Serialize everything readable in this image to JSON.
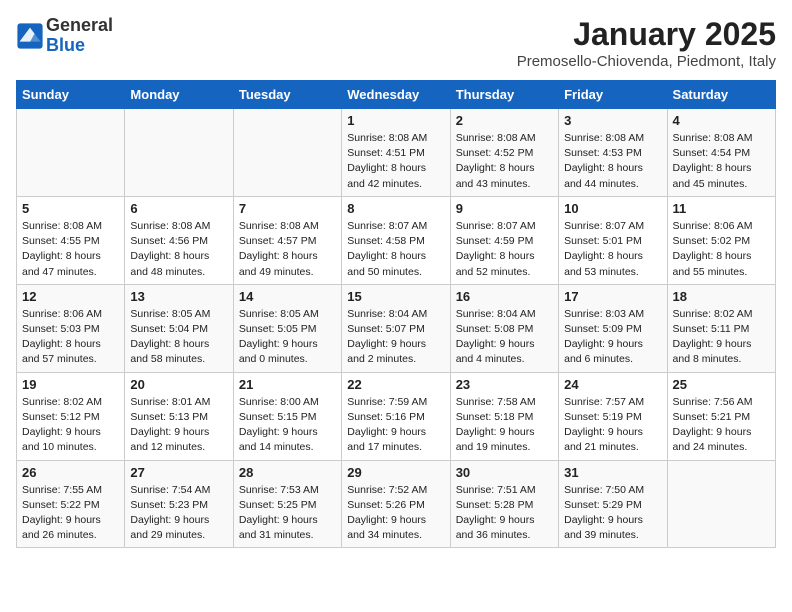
{
  "header": {
    "logo_line1": "General",
    "logo_line2": "Blue",
    "month_year": "January 2025",
    "location": "Premosello-Chiovenda, Piedmont, Italy"
  },
  "weekdays": [
    "Sunday",
    "Monday",
    "Tuesday",
    "Wednesday",
    "Thursday",
    "Friday",
    "Saturday"
  ],
  "weeks": [
    [
      {
        "day": "",
        "sunrise": "",
        "sunset": "",
        "daylight": ""
      },
      {
        "day": "",
        "sunrise": "",
        "sunset": "",
        "daylight": ""
      },
      {
        "day": "",
        "sunrise": "",
        "sunset": "",
        "daylight": ""
      },
      {
        "day": "1",
        "sunrise": "8:08 AM",
        "sunset": "4:51 PM",
        "daylight": "8 hours and 42 minutes."
      },
      {
        "day": "2",
        "sunrise": "8:08 AM",
        "sunset": "4:52 PM",
        "daylight": "8 hours and 43 minutes."
      },
      {
        "day": "3",
        "sunrise": "8:08 AM",
        "sunset": "4:53 PM",
        "daylight": "8 hours and 44 minutes."
      },
      {
        "day": "4",
        "sunrise": "8:08 AM",
        "sunset": "4:54 PM",
        "daylight": "8 hours and 45 minutes."
      }
    ],
    [
      {
        "day": "5",
        "sunrise": "8:08 AM",
        "sunset": "4:55 PM",
        "daylight": "8 hours and 47 minutes."
      },
      {
        "day": "6",
        "sunrise": "8:08 AM",
        "sunset": "4:56 PM",
        "daylight": "8 hours and 48 minutes."
      },
      {
        "day": "7",
        "sunrise": "8:08 AM",
        "sunset": "4:57 PM",
        "daylight": "8 hours and 49 minutes."
      },
      {
        "day": "8",
        "sunrise": "8:07 AM",
        "sunset": "4:58 PM",
        "daylight": "8 hours and 50 minutes."
      },
      {
        "day": "9",
        "sunrise": "8:07 AM",
        "sunset": "4:59 PM",
        "daylight": "8 hours and 52 minutes."
      },
      {
        "day": "10",
        "sunrise": "8:07 AM",
        "sunset": "5:01 PM",
        "daylight": "8 hours and 53 minutes."
      },
      {
        "day": "11",
        "sunrise": "8:06 AM",
        "sunset": "5:02 PM",
        "daylight": "8 hours and 55 minutes."
      }
    ],
    [
      {
        "day": "12",
        "sunrise": "8:06 AM",
        "sunset": "5:03 PM",
        "daylight": "8 hours and 57 minutes."
      },
      {
        "day": "13",
        "sunrise": "8:05 AM",
        "sunset": "5:04 PM",
        "daylight": "8 hours and 58 minutes."
      },
      {
        "day": "14",
        "sunrise": "8:05 AM",
        "sunset": "5:05 PM",
        "daylight": "9 hours and 0 minutes."
      },
      {
        "day": "15",
        "sunrise": "8:04 AM",
        "sunset": "5:07 PM",
        "daylight": "9 hours and 2 minutes."
      },
      {
        "day": "16",
        "sunrise": "8:04 AM",
        "sunset": "5:08 PM",
        "daylight": "9 hours and 4 minutes."
      },
      {
        "day": "17",
        "sunrise": "8:03 AM",
        "sunset": "5:09 PM",
        "daylight": "9 hours and 6 minutes."
      },
      {
        "day": "18",
        "sunrise": "8:02 AM",
        "sunset": "5:11 PM",
        "daylight": "9 hours and 8 minutes."
      }
    ],
    [
      {
        "day": "19",
        "sunrise": "8:02 AM",
        "sunset": "5:12 PM",
        "daylight": "9 hours and 10 minutes."
      },
      {
        "day": "20",
        "sunrise": "8:01 AM",
        "sunset": "5:13 PM",
        "daylight": "9 hours and 12 minutes."
      },
      {
        "day": "21",
        "sunrise": "8:00 AM",
        "sunset": "5:15 PM",
        "daylight": "9 hours and 14 minutes."
      },
      {
        "day": "22",
        "sunrise": "7:59 AM",
        "sunset": "5:16 PM",
        "daylight": "9 hours and 17 minutes."
      },
      {
        "day": "23",
        "sunrise": "7:58 AM",
        "sunset": "5:18 PM",
        "daylight": "9 hours and 19 minutes."
      },
      {
        "day": "24",
        "sunrise": "7:57 AM",
        "sunset": "5:19 PM",
        "daylight": "9 hours and 21 minutes."
      },
      {
        "day": "25",
        "sunrise": "7:56 AM",
        "sunset": "5:21 PM",
        "daylight": "9 hours and 24 minutes."
      }
    ],
    [
      {
        "day": "26",
        "sunrise": "7:55 AM",
        "sunset": "5:22 PM",
        "daylight": "9 hours and 26 minutes."
      },
      {
        "day": "27",
        "sunrise": "7:54 AM",
        "sunset": "5:23 PM",
        "daylight": "9 hours and 29 minutes."
      },
      {
        "day": "28",
        "sunrise": "7:53 AM",
        "sunset": "5:25 PM",
        "daylight": "9 hours and 31 minutes."
      },
      {
        "day": "29",
        "sunrise": "7:52 AM",
        "sunset": "5:26 PM",
        "daylight": "9 hours and 34 minutes."
      },
      {
        "day": "30",
        "sunrise": "7:51 AM",
        "sunset": "5:28 PM",
        "daylight": "9 hours and 36 minutes."
      },
      {
        "day": "31",
        "sunrise": "7:50 AM",
        "sunset": "5:29 PM",
        "daylight": "9 hours and 39 minutes."
      },
      {
        "day": "",
        "sunrise": "",
        "sunset": "",
        "daylight": ""
      }
    ]
  ]
}
